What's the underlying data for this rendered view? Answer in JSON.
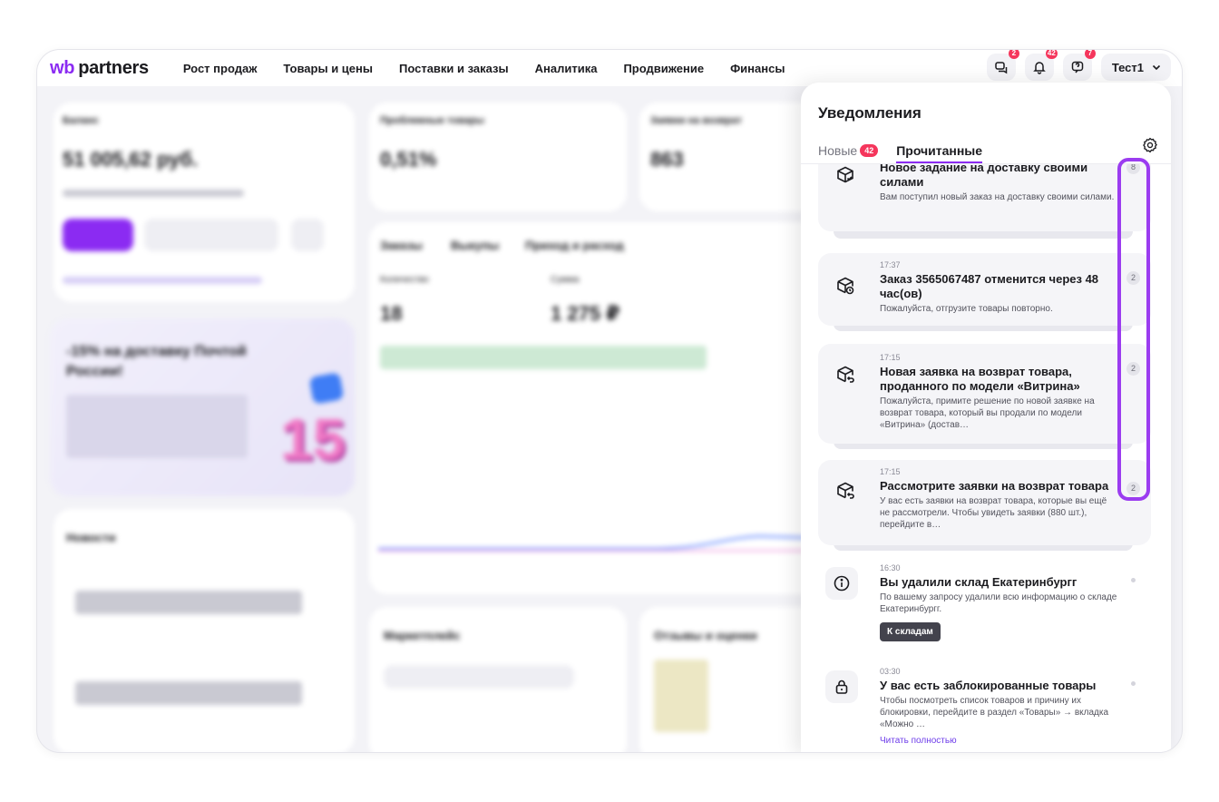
{
  "header": {
    "logo_prefix": "wb",
    "logo_text": "partners",
    "nav": [
      "Рост продаж",
      "Товары и цены",
      "Поставки и заказы",
      "Аналитика",
      "Продвижение",
      "Финансы"
    ],
    "badges": {
      "chat": "2",
      "bell": "42",
      "support": "7"
    },
    "user": "Тест1"
  },
  "dashboard": {
    "balance_label": "Баланс",
    "balance_value": "51 005,62 руб.",
    "problem_goods_label": "Проблемные товары",
    "problem_goods_value": "0,51%",
    "returns_label": "Заявки на возврат",
    "returns_value": "863",
    "tab_orders": "Заказы",
    "tab_buyouts": "Выкупы",
    "tab_flow": "Приход и расход",
    "qty_label": "Количество",
    "qty_value": "18",
    "sum_label": "Сумма",
    "sum_value": "1 275 ₽",
    "promo_title": "-15% на доставку Почтой России!",
    "promo_number": "15",
    "news_title": "Новости",
    "marketplace_title": "Маркетплейс",
    "reviews_title": "Отзывы и оценки"
  },
  "panel": {
    "title": "Уведомления",
    "tab_new": "Новые",
    "tab_new_count": "42",
    "tab_read": "Прочитанные",
    "items": [
      {
        "time": "",
        "title": "Новое задание на доставку своими силами",
        "text": "Вам поступил новый заказ на доставку своими силами.",
        "count": "8"
      },
      {
        "time": "17:37",
        "title": "Заказ 3565067487 отменится через 48 час(ов)",
        "text": "Пожалуйста, отгрузите товары повторно.",
        "count": "2"
      },
      {
        "time": "17:15",
        "title": "Новая заявка на возврат товара, проданного по модели «Витрина»",
        "text": "Пожалуйста, примите решение по новой заявке на возврат товара, который вы продали по модели «Витрина» (достав…",
        "count": "2"
      },
      {
        "time": "17:15",
        "title": "Рассмотрите заявки на возврат товара",
        "text": "У вас есть заявки на возврат товара, которые вы ещё не рассмотрели. Чтобы увидеть заявки (880 шт.), перейдите в…",
        "count": "2"
      },
      {
        "time": "16:30",
        "title": "Вы удалили склад Екатеринбургг",
        "text": "По вашему запросу удалили всю информацию о складе Екатеринбургг.",
        "button": "К складам"
      },
      {
        "time": "03:30",
        "title": "У вас есть заблокированные товары",
        "text": "Чтобы посмотреть список товаров и причину их блокировки, перейдите в раздел «Товары» → вкладка «Можно …",
        "link": "Читать полностью"
      }
    ]
  }
}
